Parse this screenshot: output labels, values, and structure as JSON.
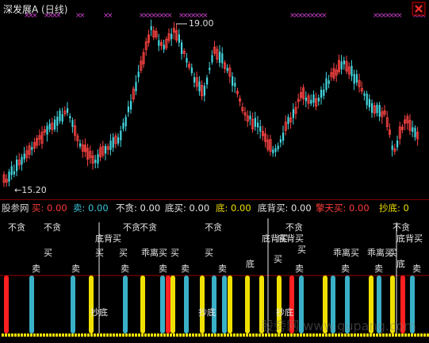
{
  "header": {
    "title": "深发展A",
    "period": "(日线)"
  },
  "price_labels": {
    "high": "19.00",
    "low": "15.20"
  },
  "status": [
    {
      "key": "label",
      "text": "股参网",
      "color": "#d6d6d6"
    },
    {
      "key": "buy",
      "text": "买: 0.00",
      "color": "#ff3b3b"
    },
    {
      "key": "sell",
      "text": "卖: 0.00",
      "color": "#39c2d7"
    },
    {
      "key": "nogreed",
      "text": "不贪: 0.00",
      "color": "#e5e5e5"
    },
    {
      "key": "bottom_buy",
      "text": "底买: 0.00",
      "color": "#e5e5e5"
    },
    {
      "key": "bottom",
      "text": "底: 0.00",
      "color": "#f0e000"
    },
    {
      "key": "bottom_div_buy",
      "text": "底背买: 0.00",
      "color": "#e5e5e5"
    },
    {
      "key": "qtm",
      "text": "擎天买: 0.00",
      "color": "#ff3b3b"
    },
    {
      "key": "chaodi",
      "text": "抄底: 0",
      "color": "#f0e000"
    }
  ],
  "indicator_labels": {
    "nogreed": "不贪",
    "buy": "买",
    "sell": "卖",
    "bottom_div_buy": "底背买",
    "guaili_buy": "乖离买",
    "bottom": "底",
    "chaodi": "抄底"
  },
  "watermark": "股旁网 www.gupang.com",
  "colors": {
    "up": "#ff4444",
    "down": "#44d7e0",
    "marker": "#d040d0",
    "yellow": "#f0e000",
    "red": "#ff2020",
    "cyan": "#39b0c8",
    "white": "#e8e8e8"
  }
}
